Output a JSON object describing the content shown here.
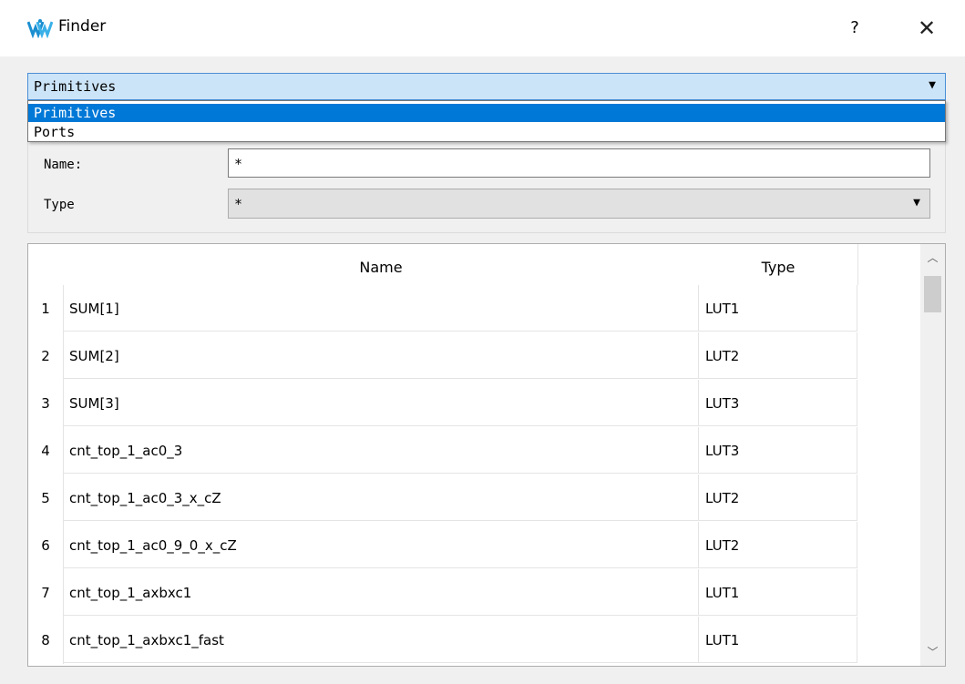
{
  "window": {
    "title": "Finder",
    "help_label": "?",
    "close_label": "✕"
  },
  "category_combo": {
    "value": "Primitives",
    "options": [
      "Primitives",
      "Ports"
    ]
  },
  "filter": {
    "name_label": "Name:",
    "name_value": "*",
    "type_label": "Type",
    "type_value": "*"
  },
  "table": {
    "columns": [
      "Name",
      "Type"
    ],
    "rows": [
      {
        "num": "1",
        "name": "SUM[1]",
        "type": "LUT1"
      },
      {
        "num": "2",
        "name": "SUM[2]",
        "type": "LUT2"
      },
      {
        "num": "3",
        "name": "SUM[3]",
        "type": "LUT3"
      },
      {
        "num": "4",
        "name": "cnt_top_1_ac0_3",
        "type": "LUT3"
      },
      {
        "num": "5",
        "name": "cnt_top_1_ac0_3_x_cZ",
        "type": "LUT2"
      },
      {
        "num": "6",
        "name": "cnt_top_1_ac0_9_0_x_cZ",
        "type": "LUT2"
      },
      {
        "num": "7",
        "name": "cnt_top_1_axbxc1",
        "type": "LUT1"
      },
      {
        "num": "8",
        "name": "cnt_top_1_axbxc1_fast",
        "type": "LUT1"
      }
    ]
  },
  "icons": {
    "app": "gowin-logo-icon",
    "dropdown": "chevron-down-icon"
  },
  "colors": {
    "selection": "#0078d7",
    "combo_bg": "#cce4f7"
  }
}
